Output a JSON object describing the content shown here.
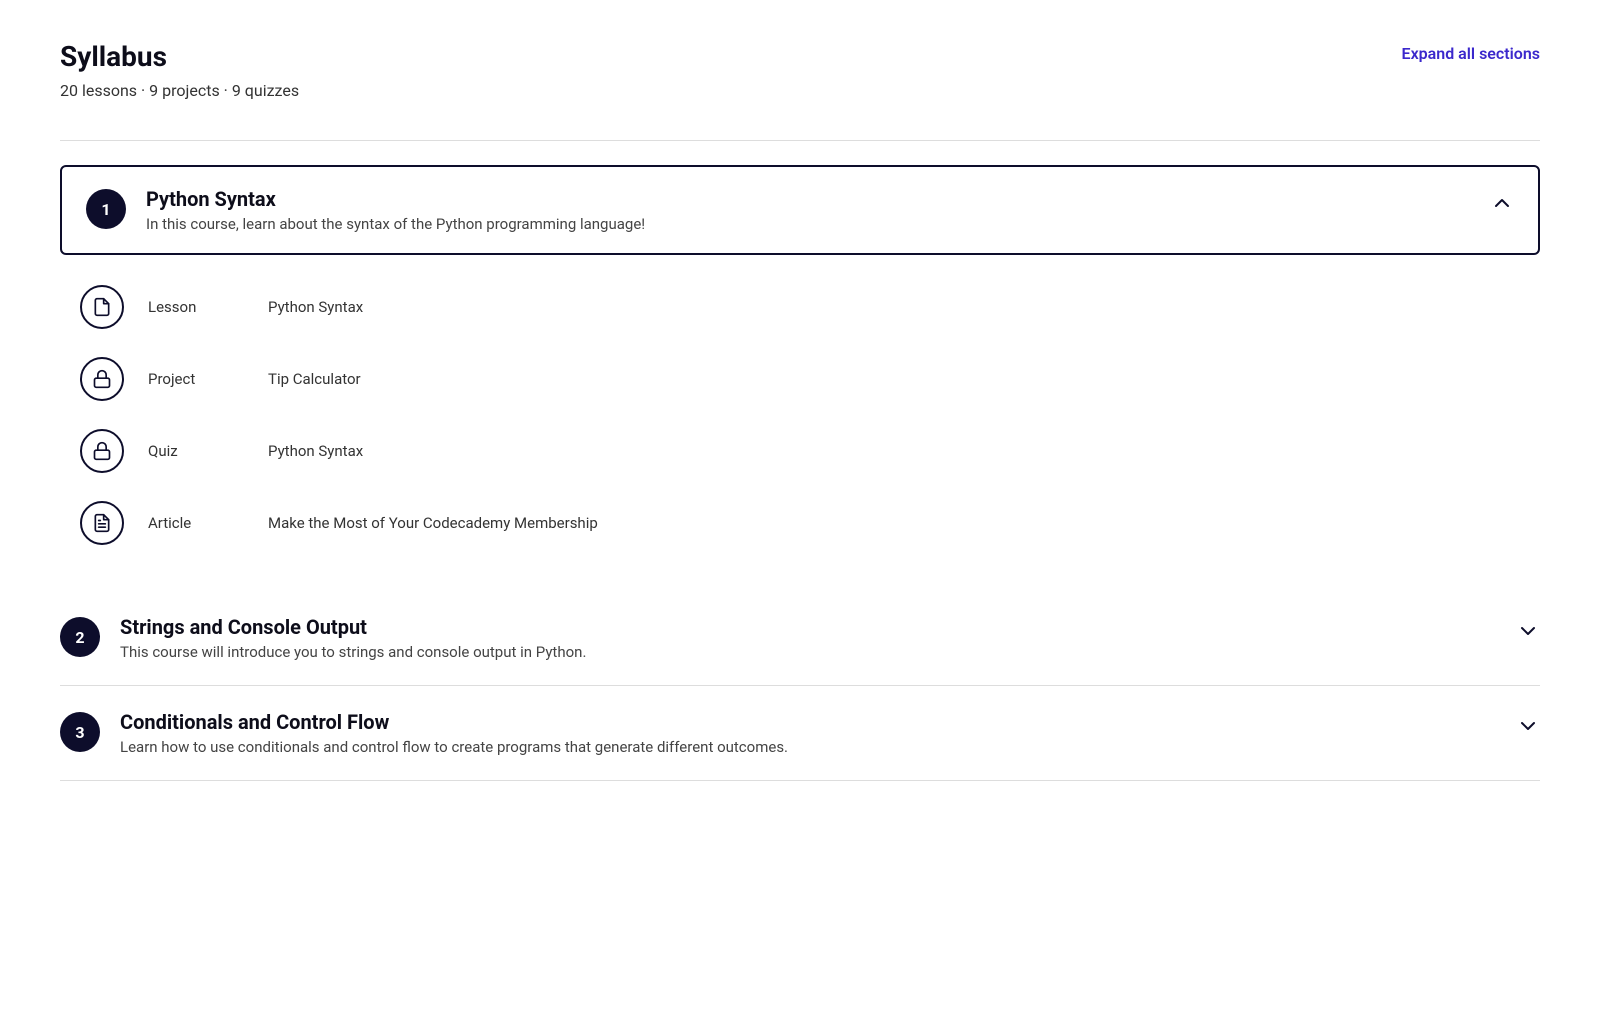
{
  "syllabus": {
    "title": "Syllabus",
    "meta": "20 lessons · 9 projects · 9 quizzes",
    "expand_all_label": "Expand all sections"
  },
  "sections": [
    {
      "number": "1",
      "name": "Python Syntax",
      "description": "In this course, learn about the syntax of the Python programming language!",
      "expanded": true,
      "items": [
        {
          "type": "Lesson",
          "icon": "lesson",
          "name": "Python Syntax"
        },
        {
          "type": "Project",
          "icon": "lock",
          "name": "Tip Calculator"
        },
        {
          "type": "Quiz",
          "icon": "lock",
          "name": "Python Syntax"
        },
        {
          "type": "Article",
          "icon": "article",
          "name": "Make the Most of Your Codecademy Membership"
        }
      ]
    },
    {
      "number": "2",
      "name": "Strings and Console Output",
      "description": "This course will introduce you to strings and console output in Python.",
      "expanded": false,
      "items": []
    },
    {
      "number": "3",
      "name": "Conditionals and Control Flow",
      "description": "Learn how to use conditionals and control flow to create programs that generate different outcomes.",
      "expanded": false,
      "items": []
    }
  ],
  "icons": {
    "lesson": "📄",
    "lock": "🔒",
    "article": "📋",
    "chevron_up": "∧",
    "chevron_down": "∨"
  }
}
